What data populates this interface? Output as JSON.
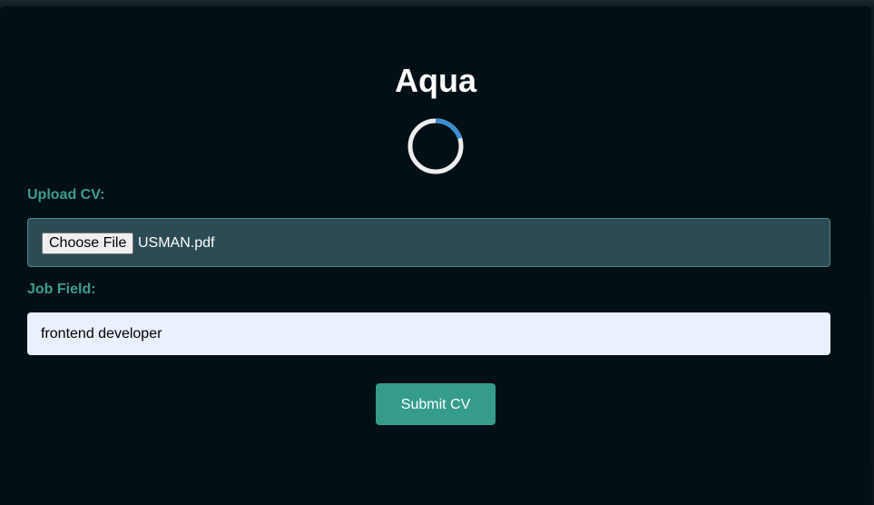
{
  "app": {
    "title": "Aqua"
  },
  "loading": {
    "icon": "loading-spinner-icon",
    "progress_fraction": 0.2
  },
  "upload": {
    "label": "Upload CV:",
    "choose_button": "Choose File",
    "file_name": "USMAN.pdf"
  },
  "job_field": {
    "label": "Job Field:",
    "value": "frontend developer"
  },
  "submit": {
    "label": "Submit CV"
  },
  "colors": {
    "background": "#020f14",
    "accent": "#359c8c",
    "label": "#3a9e8c",
    "upload_box": "#2c4b55",
    "spinner_track": "#eeeeee",
    "spinner_arc": "#3b8fd4"
  }
}
